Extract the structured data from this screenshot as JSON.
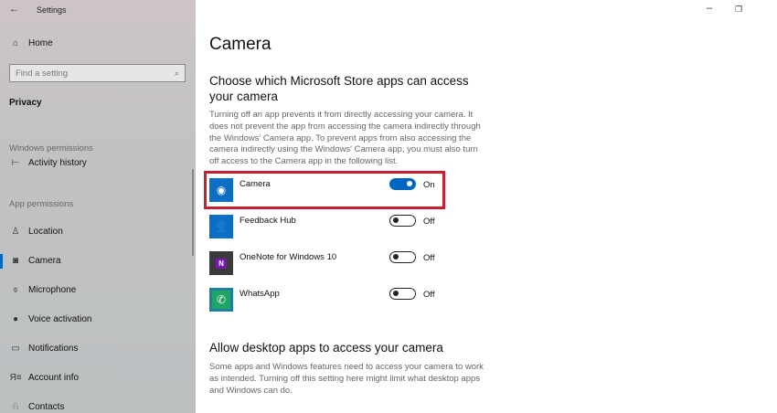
{
  "window": {
    "title": "Settings",
    "minimize": "–",
    "restore": "❐"
  },
  "sidebar": {
    "home": "Home",
    "search_placeholder": "Find a setting",
    "section": "Privacy",
    "windows_permissions": "Windows permissions",
    "activity_history": "Activity history",
    "app_permissions": "App permissions",
    "items": [
      {
        "label": "Location",
        "icon": "location-icon"
      },
      {
        "label": "Camera",
        "icon": "camera-icon",
        "selected": true
      },
      {
        "label": "Microphone",
        "icon": "microphone-icon"
      },
      {
        "label": "Voice activation",
        "icon": "voice-icon"
      },
      {
        "label": "Notifications",
        "icon": "notifications-icon"
      },
      {
        "label": "Account info",
        "icon": "account-info-icon"
      },
      {
        "label": "Contacts",
        "icon": "contacts-icon"
      }
    ]
  },
  "main": {
    "title": "Camera",
    "store_heading": "Choose which Microsoft Store apps can access your camera",
    "store_desc": "Turning off an app prevents it from directly accessing your camera. It does not prevent the app from accessing the camera indirectly through the Windows' Camera app. To prevent apps from also accessing the camera indirectly using the Windows' Camera app, you must also turn off access to the Camera app in the following list.",
    "apps": [
      {
        "name": "Camera",
        "state": "On",
        "on": true,
        "color": "#0a6fc2"
      },
      {
        "name": "Feedback Hub",
        "state": "Off",
        "on": false,
        "color": "#0a6fc2"
      },
      {
        "name": "OneNote for Windows 10",
        "state": "Off",
        "on": false,
        "color": "#3a3a3a"
      },
      {
        "name": "WhatsApp",
        "state": "Off",
        "on": false,
        "color": "#1fa463"
      }
    ],
    "desktop_heading": "Allow desktop apps to access your camera",
    "desktop_desc": "Some apps and Windows features need to access your camera to work as intended. Turning off this setting here might limit what desktop apps and Windows can do."
  },
  "colors": {
    "accent": "#0067c0",
    "highlight": "#c4202f"
  }
}
